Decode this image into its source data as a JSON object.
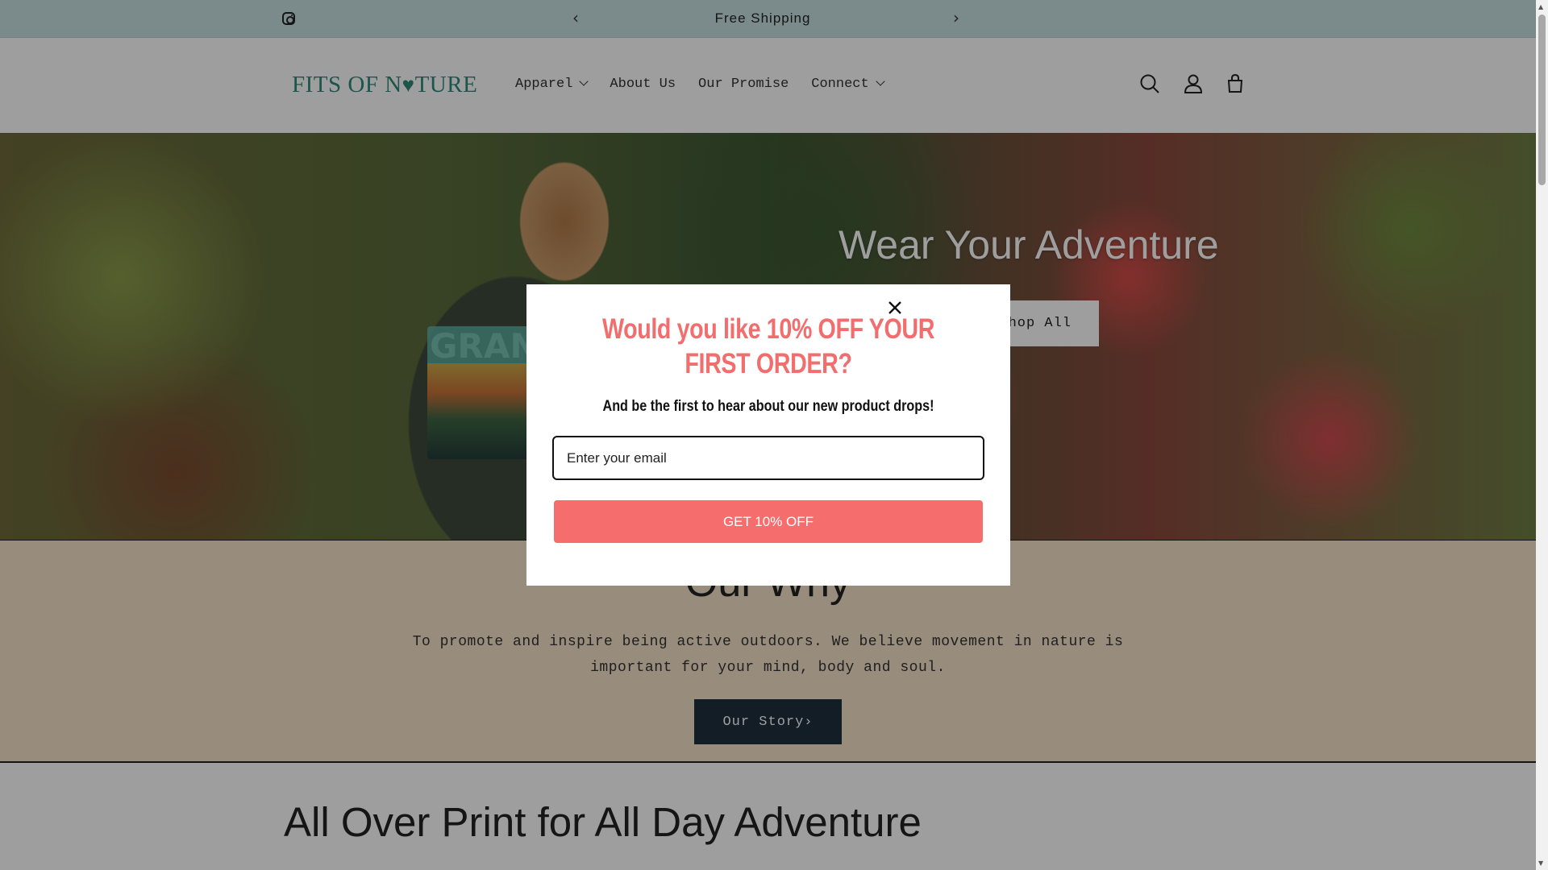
{
  "announcement": {
    "message": "Free Shipping",
    "prev_icon": "chevron-left-icon",
    "next_icon": "chevron-right-icon",
    "social_icon": "instagram-icon"
  },
  "header": {
    "logo_text_1": "FITS OF N",
    "logo_heart": "♥",
    "logo_text_2": "TURE",
    "nav": [
      {
        "label": "Apparel",
        "has_dropdown": true
      },
      {
        "label": "About Us",
        "has_dropdown": false
      },
      {
        "label": "Our Promise",
        "has_dropdown": false
      },
      {
        "label": "Connect",
        "has_dropdown": true
      }
    ],
    "icons": [
      "search-icon",
      "account-icon",
      "cart-icon"
    ]
  },
  "hero": {
    "title": "Wear Your Adventure",
    "button_label": "Shop All",
    "shirt_text": "GRAND"
  },
  "why": {
    "title": "Our Why",
    "text": "To promote and inspire being active outdoors. We believe movement in nature is important for your mind, body and soul.",
    "button_label": "Our Story›"
  },
  "collection": {
    "title": "All Over Print for All Day Adventure"
  },
  "popup": {
    "headline": "Would you like 10% OFF YOUR FIRST ORDER?",
    "subtext": "And be the first to hear about our new product drops!",
    "email_placeholder": "Enter your email",
    "cta_label": "GET 10% OFF",
    "close_icon": "close-icon"
  },
  "colors": {
    "announcement_bg": "#c7e0e0",
    "brand_teal": "#2f8a7a",
    "why_bg": "#f5e3c8",
    "dark_button": "#1f2f3e",
    "popup_accent": "#f56d6d"
  }
}
